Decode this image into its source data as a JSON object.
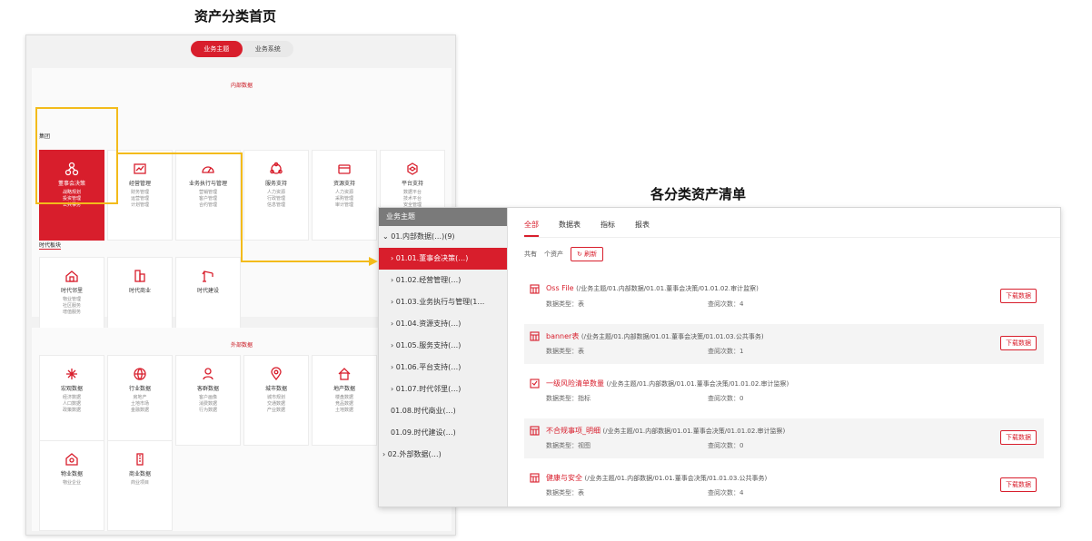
{
  "captions": {
    "left": "资产分类首页",
    "right": "各分类资产清单"
  },
  "home": {
    "toggle": [
      "业务主题",
      "业务系统"
    ],
    "internal": {
      "title": "内部数据",
      "group1_label": "集团",
      "group2_label": "时代板块",
      "tiles": [
        {
          "title": "董事会决策",
          "lines": [
            "战略规划",
            "投资管理",
            "公共事务"
          ],
          "icon": "network-icon",
          "active": true
        },
        {
          "title": "经营管理",
          "lines": [
            "财务管理",
            "运营管理",
            "计划管理"
          ],
          "icon": "chart-icon"
        },
        {
          "title": "业务执行与管理",
          "lines": [
            "营销管理",
            "客户管理",
            "合约管理"
          ],
          "icon": "gauge-icon"
        },
        {
          "title": "服务支持",
          "lines": [
            "人力资源",
            "行政管理",
            "信息管理"
          ],
          "icon": "cycle-icon"
        },
        {
          "title": "资源支持",
          "lines": [
            "人力资源",
            "采购管理",
            "审计管理"
          ],
          "icon": "wallet-icon"
        },
        {
          "title": "平台支持",
          "lines": [
            "数据平台",
            "技术平台",
            "安全管理"
          ],
          "icon": "hex-icon"
        },
        {
          "title": "时代邻里",
          "lines": [
            "物业管理",
            "社区服务",
            "增值服务"
          ],
          "icon": "house-icon"
        },
        {
          "title": "时代商业",
          "lines": [],
          "icon": "building-icon"
        },
        {
          "title": "时代建设",
          "lines": [],
          "icon": "crane-icon"
        }
      ]
    },
    "external": {
      "title": "外部数据",
      "tiles": [
        {
          "title": "宏观数据",
          "lines": [
            "经济数据",
            "人口数据",
            "政策数据"
          ],
          "icon": "snow-icon"
        },
        {
          "title": "行业数据",
          "lines": [
            "房地产",
            "土地市场",
            "金融数据"
          ],
          "icon": "globe-icon"
        },
        {
          "title": "客群数据",
          "lines": [
            "客户画像",
            "消费数据",
            "行为数据"
          ],
          "icon": "person-icon"
        },
        {
          "title": "城市数据",
          "lines": [
            "城市规划",
            "交通数据",
            "产业数据"
          ],
          "icon": "pin-icon"
        },
        {
          "title": "地产数据",
          "lines": [
            "楼盘数据",
            "竞品数据",
            "土地数据"
          ],
          "icon": "house2-icon"
        },
        {
          "title": "物业数据",
          "lines": [
            "物业企业"
          ],
          "icon": "home3-icon"
        },
        {
          "title": "商业数据",
          "lines": [
            "商业项目"
          ],
          "icon": "tower-icon"
        }
      ]
    }
  },
  "list": {
    "side_title": "业务主题",
    "tree": [
      {
        "label": "⌄ 01.内部数据(…)(9)",
        "level": "top"
      },
      {
        "label": "› 01.01.董事会决策(…)",
        "level": "child",
        "selected": true
      },
      {
        "label": "› 01.02.经营管理(…)",
        "level": "child"
      },
      {
        "label": "› 01.03.业务执行与管理(1…",
        "level": "child"
      },
      {
        "label": "› 01.04.资源支持(…)",
        "level": "child"
      },
      {
        "label": "› 01.05.服务支持(…)",
        "level": "child"
      },
      {
        "label": "› 01.06.平台支持(…)",
        "level": "child"
      },
      {
        "label": "› 01.07.时代邻里(…)",
        "level": "child"
      },
      {
        "label": "01.08.时代商业(…)",
        "level": "child"
      },
      {
        "label": "01.09.时代建设(…)",
        "level": "child"
      },
      {
        "label": "› 02.外部数据(…)",
        "level": "top"
      }
    ],
    "tabs": [
      "全部",
      "数据表",
      "指标",
      "报表"
    ],
    "filter": {
      "total": "共有",
      "unit": "个资产",
      "refresh": "刷新"
    },
    "items": [
      {
        "name": "Oss File",
        "path": "(/业务主题/01.内部数据/01.01.董事会决策/01.01.02.审计监察)",
        "type_label": "数据类型：",
        "type": "表",
        "count_label": "查阅次数：",
        "count": "4",
        "download": "下载数据",
        "shade": false,
        "icon": "table-icon"
      },
      {
        "name": "banner表",
        "path": "(/业务主题/01.内部数据/01.01.董事会决策/01.01.03.公共事务)",
        "type_label": "数据类型：",
        "type": "表",
        "count_label": "查阅次数：",
        "count": "1",
        "download": "下载数据",
        "shade": true,
        "icon": "table-icon"
      },
      {
        "name": "一级风险清单数量",
        "path": "(/业务主题/01.内部数据/01.01.董事会决策/01.01.02.审计监察)",
        "type_label": "数据类型：",
        "type": "指标",
        "count_label": "查阅次数：",
        "count": "0",
        "download": "",
        "shade": false,
        "icon": "check-icon"
      },
      {
        "name": "不合规事项_明细",
        "path": "(/业务主题/01.内部数据/01.01.董事会决策/01.01.02.审计监察)",
        "type_label": "数据类型：",
        "type": "视图",
        "count_label": "查阅次数：",
        "count": "0",
        "download": "下载数据",
        "shade": true,
        "icon": "table-icon"
      },
      {
        "name": "健康与安全",
        "path": "(/业务主题/01.内部数据/01.01.董事会决策/01.01.03.公共事务)",
        "type_label": "数据类型：",
        "type": "表",
        "count_label": "查阅次数：",
        "count": "4",
        "download": "下载数据",
        "shade": false,
        "icon": "table-icon"
      }
    ]
  },
  "colors": {
    "accent": "#d81e2c",
    "highlight": "#f3bb1b"
  }
}
